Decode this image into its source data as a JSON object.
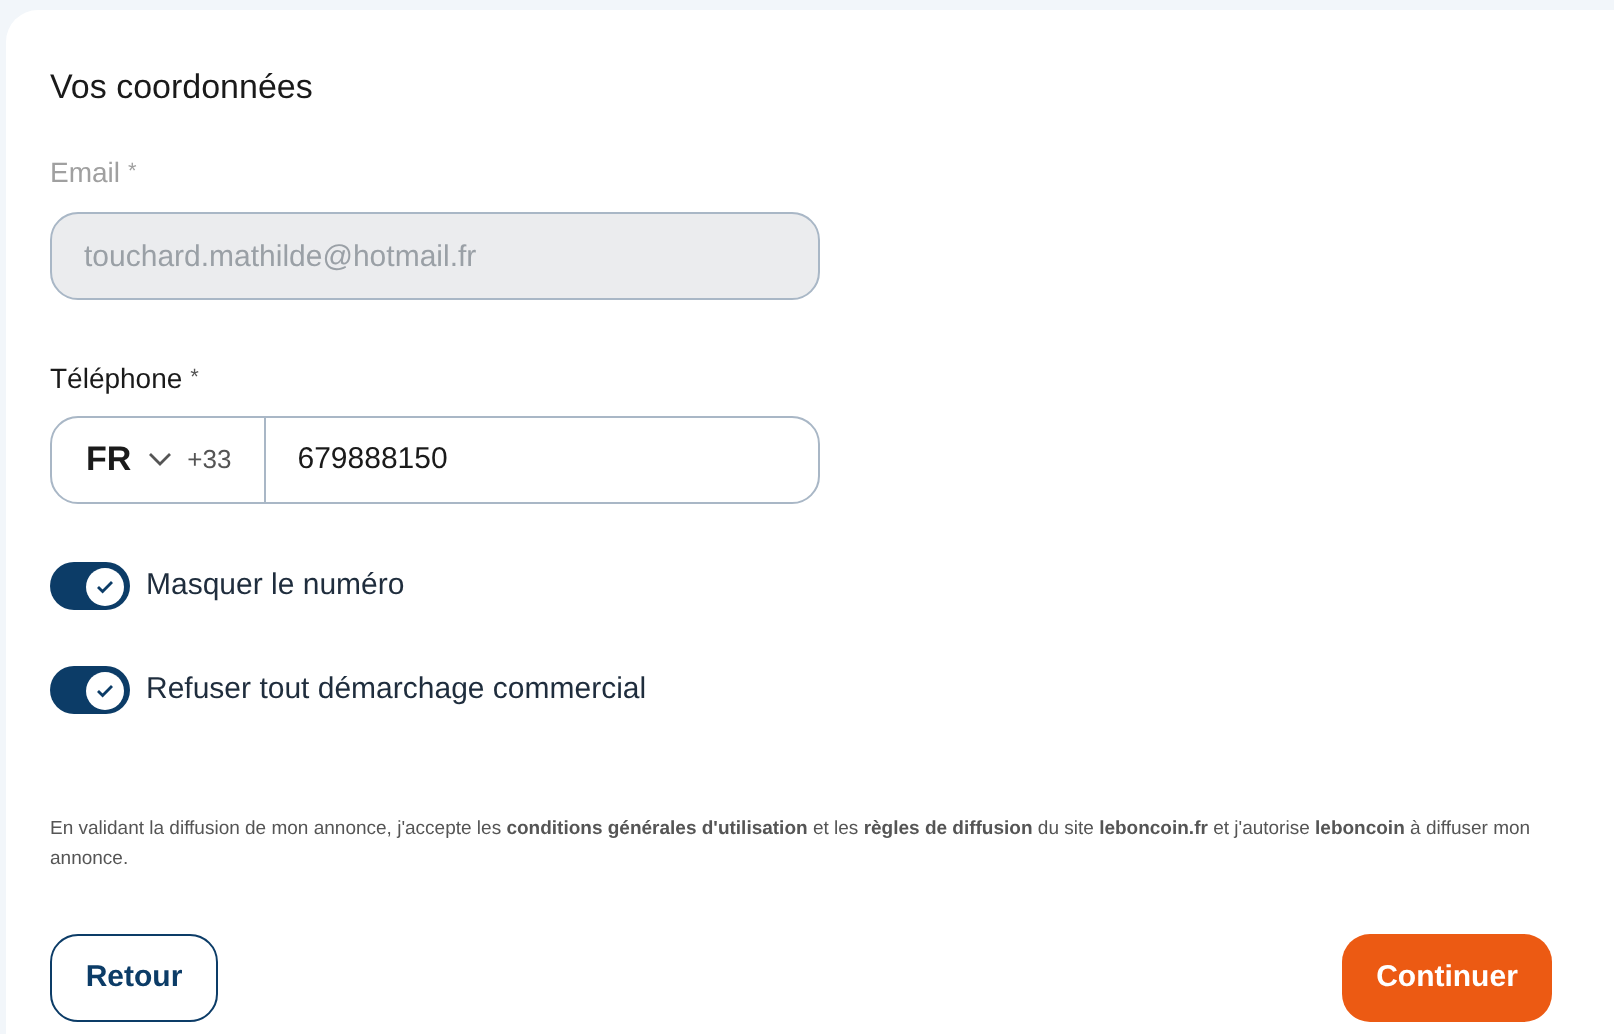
{
  "section_title": "Vos coordonnées",
  "email": {
    "label": "Email",
    "required_mark": "*",
    "value": "touchard.mathilde@hotmail.fr",
    "disabled": true
  },
  "phone": {
    "label": "Téléphone",
    "required_mark": "*",
    "country": "FR",
    "dial_code": "+33",
    "value": "679888150"
  },
  "toggles": [
    {
      "label": "Masquer le numéro",
      "on": true
    },
    {
      "label": "Refuser tout démarchage commercial",
      "on": true
    }
  ],
  "disclaimer": "En validant la diffusion de mon annonce, j'accepte les **conditions générales d'utilisation** et les **règles de diffusion** du site **leboncoin.fr** et j'autorise **leboncoin** à diffuser mon annonce.",
  "buttons": {
    "back": "Retour",
    "continue": "Continuer"
  }
}
